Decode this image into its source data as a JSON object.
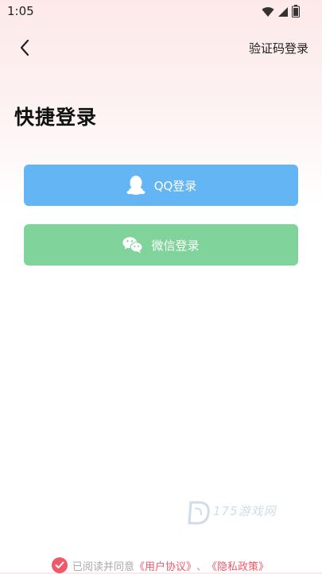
{
  "status_bar": {
    "time": "1:05",
    "icons": [
      "wifi-icon",
      "signal-icon",
      "battery-icon"
    ]
  },
  "nav": {
    "back_icon": "chevron-left-icon",
    "sms_login_label": "验证码登录"
  },
  "page": {
    "title": "快捷登录"
  },
  "buttons": {
    "qq": {
      "label": "QQ登录",
      "icon": "qq-icon",
      "color": "#64b5f3"
    },
    "wechat": {
      "label": "微信登录",
      "icon": "wechat-icon",
      "color": "#7fd39b"
    }
  },
  "watermark": {
    "text": "175游戏网"
  },
  "agreement": {
    "prefix": "已阅读并同意",
    "user_agreement": "《用户协议》",
    "separator": "、",
    "privacy_policy": "《隐私政策》",
    "accent_color": "#ef5a6a"
  }
}
